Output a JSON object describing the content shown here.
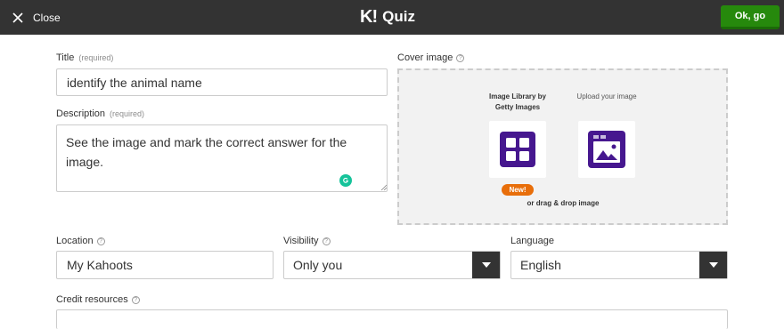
{
  "header": {
    "close_label": "Close",
    "brand_logo": "K!",
    "app_name": "Quiz",
    "ok_label": "Ok, go",
    "ok_color": "#26890c"
  },
  "form": {
    "title": {
      "label": "Title",
      "hint": "(required)",
      "value": "identify the animal name"
    },
    "description": {
      "label": "Description",
      "hint": "(required)",
      "value": "See the image and mark the correct answer for the image."
    },
    "cover_image": {
      "label": "Cover image",
      "image_library_label": "Image Library by Getty Images",
      "upload_label": "Upload your image",
      "new_badge": "New!",
      "drag_drop_label": "or drag & drop image",
      "accent_color": "#46178f"
    },
    "location": {
      "label": "Location",
      "value": "My Kahoots"
    },
    "visibility": {
      "label": "Visibility",
      "selected": "Only you"
    },
    "language": {
      "label": "Language",
      "selected": "English"
    },
    "credit_resources": {
      "label": "Credit resources",
      "value": ""
    }
  },
  "icons": {
    "close": "close-icon",
    "help": "help-icon",
    "grammarly": "grammarly-icon",
    "image_library": "image-library-icon",
    "upload": "upload-image-icon",
    "dropdown": "chevron-down-icon"
  }
}
